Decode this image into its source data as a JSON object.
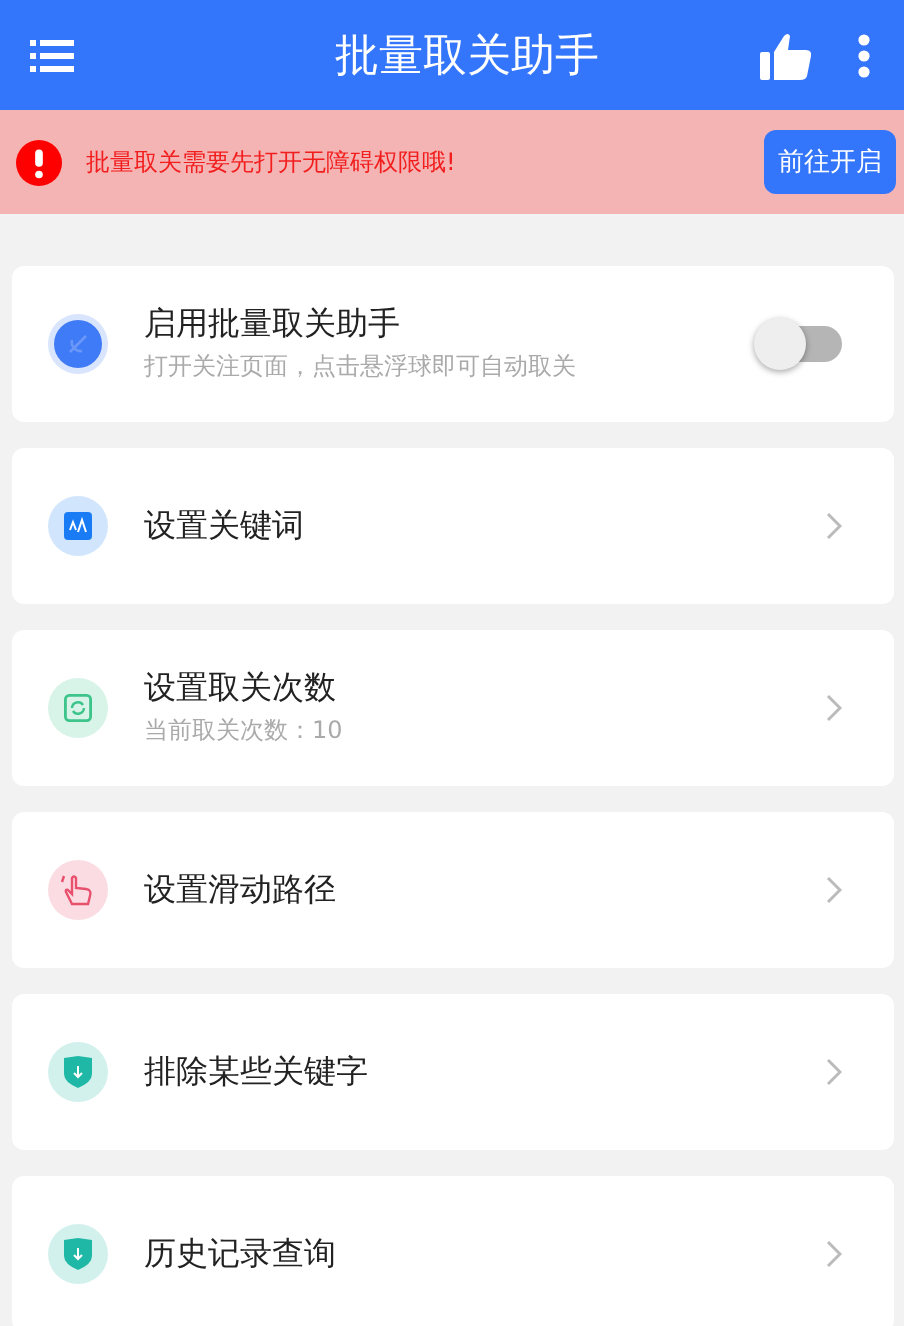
{
  "app_bar": {
    "title": "批量取关助手"
  },
  "notice": {
    "message": "批量取关需要先打开无障碍权限哦!",
    "button": "前往开启"
  },
  "items": [
    {
      "kind": "switch",
      "color": "#3f7bf6",
      "title": "启用批量取关助手",
      "subtitle": "打开关注页面，点击悬浮球即可自动取关",
      "on": false
    },
    {
      "kind": "link",
      "color": "#1a7cf5",
      "title": "设置关键词"
    },
    {
      "kind": "link",
      "color": "#3cc48a",
      "title": "设置取关次数",
      "subtitle": "当前取关次数：10"
    },
    {
      "kind": "link",
      "color": "#e8506e",
      "title": "设置滑动路径"
    },
    {
      "kind": "link",
      "color": "#1fb8a6",
      "title": "排除某些关键字"
    },
    {
      "kind": "link",
      "color": "#1fb8a6",
      "title": "历史记录查询"
    }
  ]
}
